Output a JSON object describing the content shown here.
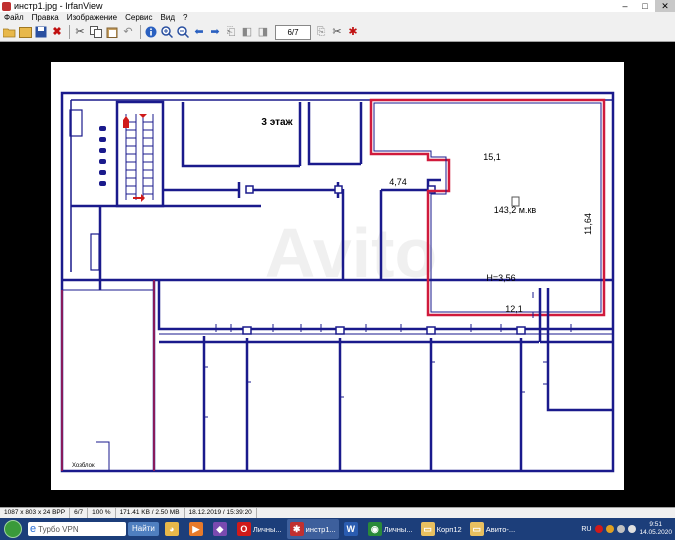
{
  "window": {
    "title": "инстр1.jpg - IrfanView",
    "min": "–",
    "max": "□",
    "close": "✕"
  },
  "menu": [
    "Файл",
    "Правка",
    "Изображение",
    "Сервис",
    "Вид",
    "?"
  ],
  "toolbar": {
    "page": "6/7"
  },
  "drawing": {
    "title": "3 этаж",
    "dim_top": "15,1",
    "dim_left": "4,74",
    "area": "143,2 м.кв",
    "dim_right": "11,64",
    "height_label": "H=3,56",
    "dim_bottom": "12,1",
    "corner_note": "Хозблок",
    "colors": {
      "walls": "#1a1a8c",
      "highlight": "#d01a3c",
      "stairs_arrow": "#d01a1a"
    }
  },
  "status": {
    "dims": "1087 x 803 x 24 BPP",
    "page": "6/7",
    "zoom": "100 %",
    "size": "171.41 KB / 2.50 MB",
    "datetime": "18.12.2019 / 15:39:20"
  },
  "taskbar": {
    "search_placeholder": "Турбо VPN",
    "go": "Найти",
    "apps": [
      {
        "label": "",
        "color": "#e8b84a",
        "glyph": "◕"
      },
      {
        "label": "",
        "color": "#e87a2a",
        "glyph": "▶"
      },
      {
        "label": "",
        "color": "#7a4ab0",
        "glyph": "◆"
      },
      {
        "label": "Личны...",
        "color": "#d01a1a",
        "glyph": "O"
      },
      {
        "label": "инстр1...",
        "color": "#c03030",
        "glyph": "✱"
      },
      {
        "label": "",
        "color": "#2a5cb0",
        "glyph": "W"
      },
      {
        "label": "Личны...",
        "color": "#2a8a3a",
        "glyph": "◉"
      },
      {
        "label": "Корп12",
        "color": "#e8c060",
        "glyph": "▭"
      },
      {
        "label": "Авито-...",
        "color": "#e8c060",
        "glyph": "▭"
      }
    ],
    "lang": "RU",
    "time": "9:51",
    "date": "14.05.2020"
  }
}
